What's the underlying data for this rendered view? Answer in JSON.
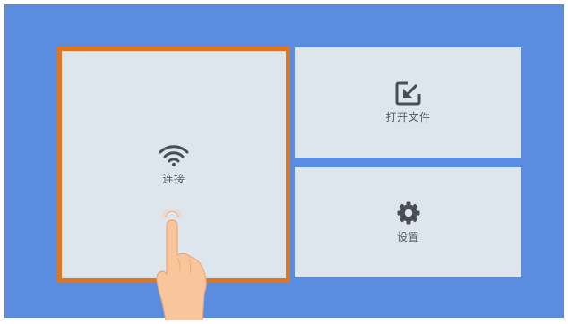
{
  "tiles": {
    "connect": {
      "label": "连接",
      "icon": "wifi-icon"
    },
    "open_file": {
      "label": "打开文件",
      "icon": "open-file-icon"
    },
    "settings": {
      "label": "设置",
      "icon": "gear-icon"
    }
  },
  "colors": {
    "background": "#5a8ddf",
    "tile": "#dee6ed",
    "selection_border": "#e0761f",
    "icon": "#4a4f55"
  }
}
